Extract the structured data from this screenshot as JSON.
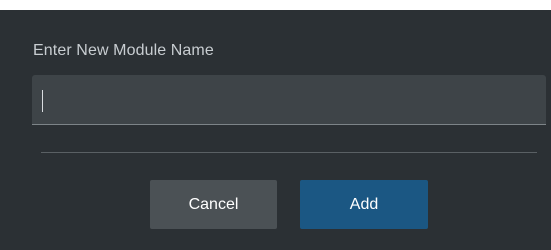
{
  "dialog": {
    "label": "Enter New Module Name",
    "input_value": "",
    "cancel_label": "Cancel",
    "add_label": "Add"
  },
  "colors": {
    "dialog_background": "#2b3034",
    "input_background": "#3e4448",
    "cancel_button": "#4b5155",
    "add_button": "#1b5783"
  }
}
